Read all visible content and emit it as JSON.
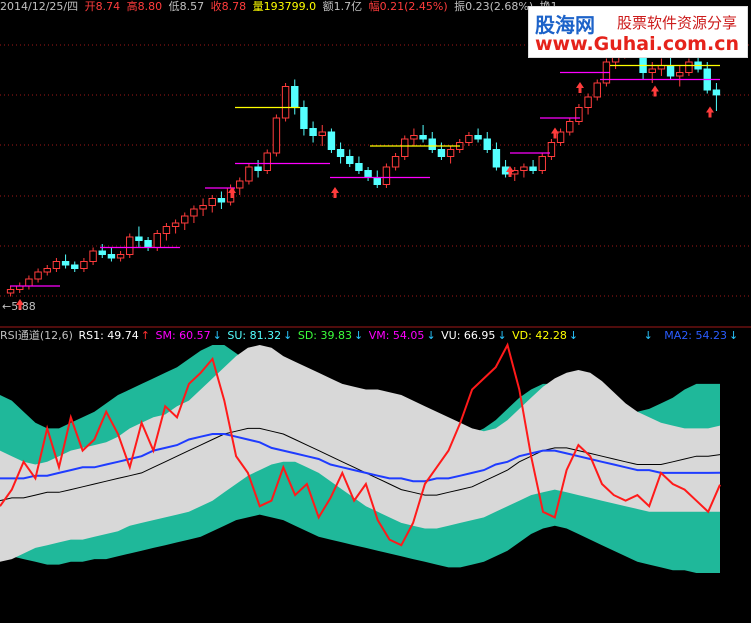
{
  "header": {
    "date": "2014/12/25/四",
    "open": "开8.74",
    "high": "高8.80",
    "low": "低8.57",
    "close": "收8.78",
    "volume": "量193799.0",
    "amount": "额1.7亿",
    "change": "幅0.21(2.45%)",
    "amplitude": "振0.23(2.68%)",
    "turnover": "换1"
  },
  "logo": {
    "name_cn": "股海网",
    "tagline": "股票软件资源分享",
    "url": "www.Guhai.com.cn"
  },
  "price_panel": {
    "low_marker": "←5.88"
  },
  "indicator_header": {
    "name": "RSI通道(12,6)",
    "rs1": "RS1: 49.74",
    "sm": "SM: 60.57",
    "su": "SU: 81.32",
    "sd": "SD: 39.83",
    "vm": "VM: 54.05",
    "vu": "VU: 66.95",
    "vd": "VD: 42.28",
    "ma2": "MA2: 54.23",
    "arrow_up": "↑",
    "arrow_down": "↓"
  },
  "colors": {
    "background": "#000000",
    "up_candle": "#ff3c3c",
    "down_candle": "#54ffff",
    "magenta": "#ff00ff",
    "yellow": "#ffff00",
    "teal": "#1fb89a",
    "grey_band": "#d8d8d8",
    "rsi_line": "#ff1a1a",
    "ma_line": "#1f3cff",
    "thin_line": "#000000",
    "grid": "#a01818"
  },
  "chart_data": [
    {
      "type": "candlestick",
      "candles": [
        [
          5.95,
          6.05,
          5.9,
          6.0
        ],
        [
          6.0,
          6.1,
          5.95,
          6.05
        ],
        [
          6.05,
          6.2,
          6.0,
          6.15
        ],
        [
          6.15,
          6.3,
          6.1,
          6.25
        ],
        [
          6.25,
          6.35,
          6.2,
          6.3
        ],
        [
          6.3,
          6.45,
          6.25,
          6.4
        ],
        [
          6.4,
          6.5,
          6.3,
          6.35
        ],
        [
          6.35,
          6.4,
          6.25,
          6.3
        ],
        [
          6.3,
          6.45,
          6.25,
          6.4
        ],
        [
          6.4,
          6.6,
          6.35,
          6.55
        ],
        [
          6.55,
          6.65,
          6.45,
          6.5
        ],
        [
          6.5,
          6.6,
          6.4,
          6.45
        ],
        [
          6.45,
          6.55,
          6.4,
          6.5
        ],
        [
          6.5,
          6.8,
          6.45,
          6.75
        ],
        [
          6.75,
          6.9,
          6.6,
          6.7
        ],
        [
          6.7,
          6.75,
          6.55,
          6.6
        ],
        [
          6.6,
          6.85,
          6.55,
          6.8
        ],
        [
          6.8,
          6.95,
          6.7,
          6.9
        ],
        [
          6.9,
          7.0,
          6.8,
          6.95
        ],
        [
          6.95,
          7.1,
          6.85,
          7.05
        ],
        [
          7.05,
          7.2,
          6.95,
          7.15
        ],
        [
          7.15,
          7.3,
          7.05,
          7.2
        ],
        [
          7.2,
          7.35,
          7.1,
          7.3
        ],
        [
          7.3,
          7.4,
          7.15,
          7.25
        ],
        [
          7.25,
          7.5,
          7.2,
          7.45
        ],
        [
          7.45,
          7.6,
          7.35,
          7.55
        ],
        [
          7.55,
          7.8,
          7.5,
          7.75
        ],
        [
          7.75,
          7.85,
          7.6,
          7.7
        ],
        [
          7.7,
          8.0,
          7.65,
          7.95
        ],
        [
          7.95,
          8.5,
          7.9,
          8.45
        ],
        [
          8.45,
          8.95,
          8.4,
          8.9
        ],
        [
          8.9,
          9.0,
          8.5,
          8.6
        ],
        [
          8.6,
          8.7,
          8.2,
          8.3
        ],
        [
          8.3,
          8.4,
          8.1,
          8.2
        ],
        [
          8.2,
          8.35,
          8.05,
          8.25
        ],
        [
          8.25,
          8.3,
          7.95,
          8.0
        ],
        [
          8.0,
          8.1,
          7.8,
          7.9
        ],
        [
          7.9,
          8.0,
          7.75,
          7.8
        ],
        [
          7.8,
          7.9,
          7.65,
          7.7
        ],
        [
          7.7,
          7.75,
          7.55,
          7.6
        ],
        [
          7.6,
          7.7,
          7.45,
          7.5
        ],
        [
          7.5,
          7.8,
          7.45,
          7.75
        ],
        [
          7.75,
          7.95,
          7.7,
          7.9
        ],
        [
          7.9,
          8.2,
          7.85,
          8.15
        ],
        [
          8.15,
          8.3,
          8.05,
          8.2
        ],
        [
          8.2,
          8.35,
          8.1,
          8.15
        ],
        [
          8.15,
          8.25,
          7.95,
          8.0
        ],
        [
          8.0,
          8.1,
          7.85,
          7.9
        ],
        [
          7.9,
          8.05,
          7.8,
          8.0
        ],
        [
          8.0,
          8.15,
          7.95,
          8.1
        ],
        [
          8.1,
          8.25,
          8.05,
          8.2
        ],
        [
          8.2,
          8.3,
          8.1,
          8.15
        ],
        [
          8.15,
          8.25,
          7.95,
          8.0
        ],
        [
          8.0,
          8.1,
          7.7,
          7.75
        ],
        [
          7.75,
          7.85,
          7.6,
          7.65
        ],
        [
          7.65,
          7.75,
          7.55,
          7.7
        ],
        [
          7.7,
          7.8,
          7.6,
          7.75
        ],
        [
          7.75,
          7.85,
          7.65,
          7.7
        ],
        [
          7.7,
          7.95,
          7.65,
          7.9
        ],
        [
          7.9,
          8.15,
          7.85,
          8.1
        ],
        [
          8.1,
          8.3,
          8.05,
          8.25
        ],
        [
          8.25,
          8.45,
          8.2,
          8.4
        ],
        [
          8.4,
          8.65,
          8.35,
          8.6
        ],
        [
          8.6,
          8.8,
          8.5,
          8.75
        ],
        [
          8.75,
          9.0,
          8.7,
          8.95
        ],
        [
          8.95,
          9.3,
          8.9,
          9.25
        ],
        [
          9.25,
          9.5,
          9.15,
          9.4
        ],
        [
          9.4,
          9.65,
          9.3,
          9.55
        ],
        [
          9.55,
          9.8,
          9.45,
          9.35
        ],
        [
          9.35,
          9.45,
          9.0,
          9.1
        ],
        [
          9.1,
          9.25,
          8.95,
          9.15
        ],
        [
          9.15,
          9.3,
          9.05,
          9.2
        ],
        [
          9.2,
          9.35,
          9.0,
          9.05
        ],
        [
          9.05,
          9.2,
          8.9,
          9.1
        ],
        [
          9.1,
          9.3,
          9.05,
          9.25
        ],
        [
          9.25,
          9.4,
          9.1,
          9.15
        ],
        [
          9.15,
          9.25,
          8.8,
          8.85
        ],
        [
          8.85,
          8.95,
          8.55,
          8.78
        ]
      ]
    },
    {
      "type": "area",
      "xlabel": "",
      "ylabel": "",
      "series": [
        {
          "name": "SU",
          "values": [
            62,
            60,
            58,
            57,
            58,
            60,
            62,
            63,
            64,
            65,
            67,
            70,
            72,
            74,
            75,
            78,
            80,
            84,
            88,
            92,
            96,
            99,
            100,
            99,
            96,
            94,
            92,
            90,
            88,
            86,
            85,
            84,
            84,
            83,
            82,
            80,
            78,
            76,
            74,
            72,
            70,
            69,
            70,
            73,
            77,
            81,
            85,
            88,
            90,
            91,
            90,
            87,
            83,
            79,
            76,
            74,
            72,
            71,
            70,
            70,
            70,
            71
          ]
        },
        {
          "name": "SD",
          "values": [
            22,
            23,
            25,
            27,
            28,
            29,
            30,
            30,
            31,
            32,
            33,
            35,
            36,
            37,
            38,
            39,
            40,
            42,
            44,
            47,
            50,
            53,
            55,
            57,
            58,
            58,
            56,
            54,
            51,
            48,
            45,
            42,
            40,
            38,
            36,
            35,
            34,
            34,
            35,
            36,
            37,
            38,
            40,
            42,
            44,
            46,
            47,
            48,
            47,
            46,
            45,
            44,
            43,
            42,
            41,
            40,
            40,
            40,
            40,
            40,
            40,
            40
          ]
        },
        {
          "name": "VU",
          "values": [
            82,
            80,
            76,
            72,
            70,
            70,
            72,
            74,
            76,
            79,
            82,
            84,
            86,
            88,
            90,
            92,
            95,
            98,
            100,
            100,
            97,
            94,
            90,
            86,
            82,
            79,
            76,
            74,
            73,
            73,
            74,
            75,
            76,
            76,
            75,
            73,
            70,
            68,
            67,
            67,
            68,
            70,
            73,
            77,
            81,
            84,
            86,
            86,
            85,
            83,
            81,
            79,
            77,
            76,
            76,
            77,
            79,
            81,
            84,
            86,
            86,
            86
          ]
        },
        {
          "name": "VD",
          "values": [
            25,
            24,
            23,
            22,
            21,
            21,
            22,
            22,
            23,
            23,
            24,
            25,
            26,
            27,
            28,
            29,
            30,
            31,
            33,
            35,
            37,
            38,
            39,
            38,
            37,
            35,
            33,
            31,
            30,
            29,
            28,
            27,
            26,
            25,
            24,
            23,
            22,
            21,
            20,
            20,
            21,
            22,
            24,
            26,
            29,
            32,
            34,
            35,
            34,
            32,
            30,
            28,
            26,
            24,
            22,
            21,
            20,
            19,
            19,
            18,
            18,
            18
          ]
        },
        {
          "name": "RS1",
          "values": [
            42,
            48,
            58,
            52,
            70,
            56,
            74,
            62,
            66,
            76,
            68,
            56,
            72,
            62,
            78,
            74,
            86,
            90,
            95,
            80,
            60,
            54,
            42,
            44,
            56,
            46,
            50,
            38,
            45,
            54,
            44,
            50,
            37,
            30,
            28,
            36,
            50,
            56,
            62,
            72,
            84,
            88,
            92,
            100,
            84,
            60,
            40,
            38,
            55,
            64,
            60,
            50,
            46,
            44,
            46,
            42,
            54,
            50,
            48,
            44,
            40,
            49.74
          ]
        },
        {
          "name": "SM",
          "values": [
            44,
            45,
            45,
            46,
            47,
            47,
            48,
            49,
            50,
            51,
            52,
            53,
            54,
            56,
            58,
            60,
            62,
            64,
            66,
            68,
            69,
            70,
            70,
            69,
            68,
            66,
            64,
            62,
            60,
            58,
            56,
            54,
            52,
            50,
            48,
            47,
            46,
            46,
            47,
            48,
            49,
            51,
            53,
            55,
            58,
            60,
            62,
            63,
            63,
            62,
            61,
            60,
            59,
            58,
            57,
            57,
            57,
            58,
            59,
            60,
            60,
            60.57
          ]
        },
        {
          "name": "VM",
          "values": [
            52,
            52,
            52,
            53,
            53,
            54,
            55,
            56,
            56,
            57,
            58,
            59,
            60,
            62,
            63,
            64,
            66,
            67,
            68,
            68,
            67,
            66,
            65,
            63,
            62,
            61,
            60,
            59,
            57,
            56,
            55,
            54,
            53,
            52,
            52,
            51,
            51,
            52,
            52,
            53,
            54,
            55,
            57,
            58,
            60,
            61,
            62,
            62,
            61,
            60,
            59,
            58,
            57,
            56,
            55,
            55,
            54,
            54,
            54,
            54,
            54,
            54.05
          ]
        }
      ]
    }
  ]
}
